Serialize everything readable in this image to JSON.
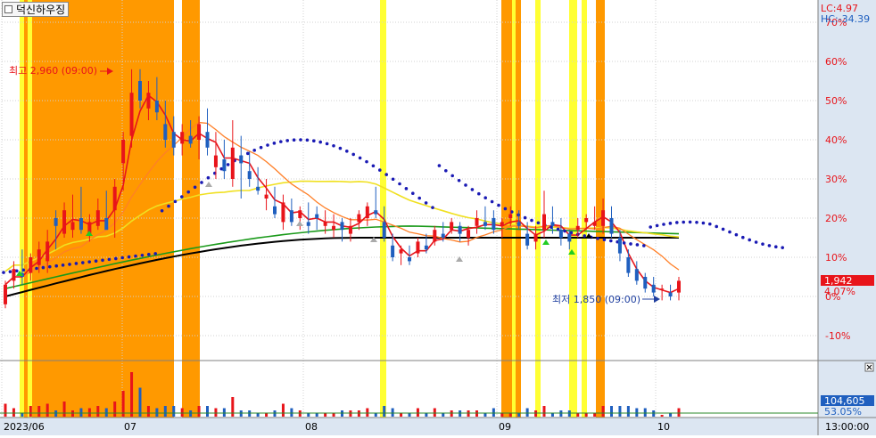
{
  "header": {
    "stock_name": "덕신하우징",
    "lc_label": "LC:4.97",
    "hc_label": "HC:-34.39"
  },
  "markers": {
    "high_label": "최고 2,960 (09:00)",
    "low_label": "최저 1,850 (09:00)"
  },
  "price_badge": {
    "price": "1,942",
    "change": "4.07%"
  },
  "volume_badge": {
    "volume": "104,605",
    "percent": "53.05%"
  },
  "time_label": "13:00:00",
  "colors": {
    "up": "#e8141a",
    "down": "#1f5fbf",
    "orange_band": "#ff9900",
    "yellow_band": "#ffff33",
    "ma5": "#e8141a",
    "ma20": "#ff7f27",
    "ma60": "#f0e020",
    "ma120": "#1a9a1a",
    "ma240": "#000000",
    "cloud": "#1a1ab4",
    "axis_text": "#e8141a",
    "badge_bg": "#e8141a",
    "vol_badge_bg": "#1f5fbf"
  },
  "chart_data": {
    "type": "candlestick",
    "title": "덕신하우징",
    "y_axis": {
      "unit": "%",
      "ticks": [
        "-10%",
        "0%",
        "10%",
        "20%",
        "30%",
        "40%",
        "50%",
        "60%",
        "70%"
      ],
      "range": [
        -13,
        73
      ]
    },
    "x_axis": {
      "ticks": [
        "2023/06",
        "07",
        "08",
        "09",
        "10"
      ]
    },
    "current": {
      "price": 1942,
      "change_pct": 4.07
    },
    "high": {
      "price": 2960,
      "time": "09:00",
      "pct": 58
    },
    "low": {
      "price": 1850,
      "time": "09:00",
      "pct": -0.5
    },
    "lc": 4.97,
    "hc": -34.39,
    "volume": {
      "last": 104605,
      "pct": 53.05
    },
    "candles": [
      [
        0,
        -2,
        4,
        -3,
        3
      ],
      [
        3,
        4,
        9,
        2,
        7
      ],
      [
        7,
        6,
        12,
        3,
        5
      ],
      [
        5,
        6,
        11,
        4,
        10
      ],
      [
        10,
        8,
        14,
        6,
        12
      ],
      [
        12,
        9,
        17,
        6,
        14
      ],
      [
        14,
        20,
        22,
        12,
        18
      ],
      [
        18,
        16,
        24,
        15,
        22
      ],
      [
        22,
        17,
        26,
        15,
        19
      ],
      [
        19,
        20,
        28,
        16,
        17
      ],
      [
        17,
        16,
        21,
        14,
        19
      ],
      [
        19,
        18,
        25,
        17,
        22
      ],
      [
        22,
        20,
        27,
        18,
        17
      ],
      [
        17,
        22,
        30,
        15,
        28
      ],
      [
        28,
        34,
        42,
        27,
        40
      ],
      [
        40,
        41,
        58,
        38,
        52
      ],
      [
        52,
        55,
        58,
        48,
        50
      ],
      [
        50,
        48,
        55,
        45,
        52
      ],
      [
        52,
        50,
        56,
        45,
        47
      ],
      [
        47,
        44,
        50,
        38,
        40
      ],
      [
        40,
        42,
        46,
        36,
        38
      ],
      [
        38,
        39,
        44,
        36,
        42
      ],
      [
        42,
        41,
        45,
        38,
        39
      ],
      [
        39,
        40,
        46,
        35,
        44
      ],
      [
        44,
        42,
        48,
        36,
        38
      ],
      [
        38,
        33,
        42,
        30,
        36
      ],
      [
        36,
        35,
        40,
        30,
        32
      ],
      [
        32,
        30,
        45,
        28,
        38
      ],
      [
        38,
        36,
        41,
        25,
        34
      ],
      [
        34,
        32,
        37,
        28,
        30
      ],
      [
        30,
        28,
        33,
        26,
        27
      ],
      [
        27,
        25,
        30,
        22,
        26
      ],
      [
        26,
        23,
        28,
        20,
        21
      ],
      [
        21,
        19,
        26,
        17,
        24
      ],
      [
        24,
        22,
        25,
        18,
        19
      ],
      [
        19,
        20,
        23,
        17,
        22
      ],
      [
        22,
        19,
        24,
        16,
        18
      ],
      [
        18,
        21,
        23,
        17,
        20
      ],
      [
        20,
        18,
        22,
        16,
        19
      ],
      [
        19,
        17,
        21,
        15,
        18
      ],
      [
        18,
        19,
        20,
        14,
        17
      ],
      [
        17,
        16,
        20,
        14,
        18
      ],
      [
        18,
        19,
        22,
        17,
        21
      ],
      [
        21,
        20,
        24,
        18,
        23
      ],
      [
        23,
        22,
        28,
        20,
        21
      ],
      [
        21,
        19,
        23,
        14,
        15
      ],
      [
        15,
        13,
        16,
        9,
        10
      ],
      [
        10,
        11,
        13,
        8,
        12
      ],
      [
        12,
        10,
        13,
        8,
        9
      ],
      [
        9,
        11,
        15,
        10,
        14
      ],
      [
        14,
        13,
        16,
        11,
        12
      ],
      [
        12,
        14,
        18,
        13,
        17
      ],
      [
        17,
        16,
        19,
        14,
        15
      ],
      [
        15,
        17,
        20,
        16,
        19
      ],
      [
        19,
        18,
        19,
        14,
        16
      ],
      [
        16,
        15,
        18,
        13,
        17
      ],
      [
        17,
        18,
        22,
        16,
        20
      ],
      [
        20,
        19,
        23,
        17,
        18
      ],
      [
        18,
        20,
        22,
        16,
        17
      ],
      [
        17,
        18,
        20,
        15,
        19
      ],
      [
        19,
        20,
        23,
        18,
        21
      ],
      [
        21,
        19,
        22,
        17,
        18
      ],
      [
        18,
        16,
        19,
        12,
        13
      ],
      [
        13,
        14,
        18,
        12,
        16
      ],
      [
        16,
        17,
        27,
        15,
        21
      ],
      [
        21,
        19,
        23,
        16,
        18
      ],
      [
        18,
        17,
        20,
        13,
        15
      ],
      [
        15,
        16,
        17,
        12,
        14
      ],
      [
        14,
        17,
        20,
        15,
        18
      ],
      [
        18,
        19,
        21,
        17,
        20
      ],
      [
        20,
        18,
        23,
        17,
        19
      ],
      [
        19,
        18,
        25,
        16,
        22
      ],
      [
        22,
        20,
        23,
        15,
        16
      ],
      [
        16,
        15,
        17,
        9,
        11
      ],
      [
        11,
        10,
        12,
        5,
        6
      ],
      [
        6,
        7,
        9,
        3,
        4
      ],
      [
        4,
        5,
        6,
        1,
        2
      ],
      [
        2,
        3,
        5,
        0,
        1
      ],
      [
        1,
        2,
        3,
        -1,
        2
      ],
      [
        2,
        1,
        3,
        -1,
        0
      ],
      [
        0,
        1,
        5,
        -1,
        4
      ]
    ]
  }
}
